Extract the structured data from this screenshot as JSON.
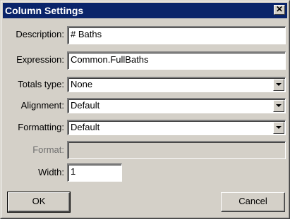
{
  "window": {
    "title": "Column Settings",
    "close_glyph": "✕"
  },
  "fields": {
    "description": {
      "label": "Description:",
      "value": "# Baths"
    },
    "expression": {
      "label": "Expression:",
      "value": "Common.FullBaths"
    },
    "totals_type": {
      "label": "Totals type:",
      "value": "None"
    },
    "alignment": {
      "label": "Alignment:",
      "value": "Default"
    },
    "formatting": {
      "label": "Formatting:",
      "value": "Default"
    },
    "format": {
      "label": "Format:",
      "value": ""
    },
    "width": {
      "label": "Width:",
      "value": "1"
    }
  },
  "buttons": {
    "ok": "OK",
    "cancel": "Cancel"
  },
  "icons": {
    "close": "close-icon",
    "dropdown": "chevron-down-icon"
  },
  "colors": {
    "titlebar": "#0a246a",
    "face": "#d4d0c8"
  }
}
